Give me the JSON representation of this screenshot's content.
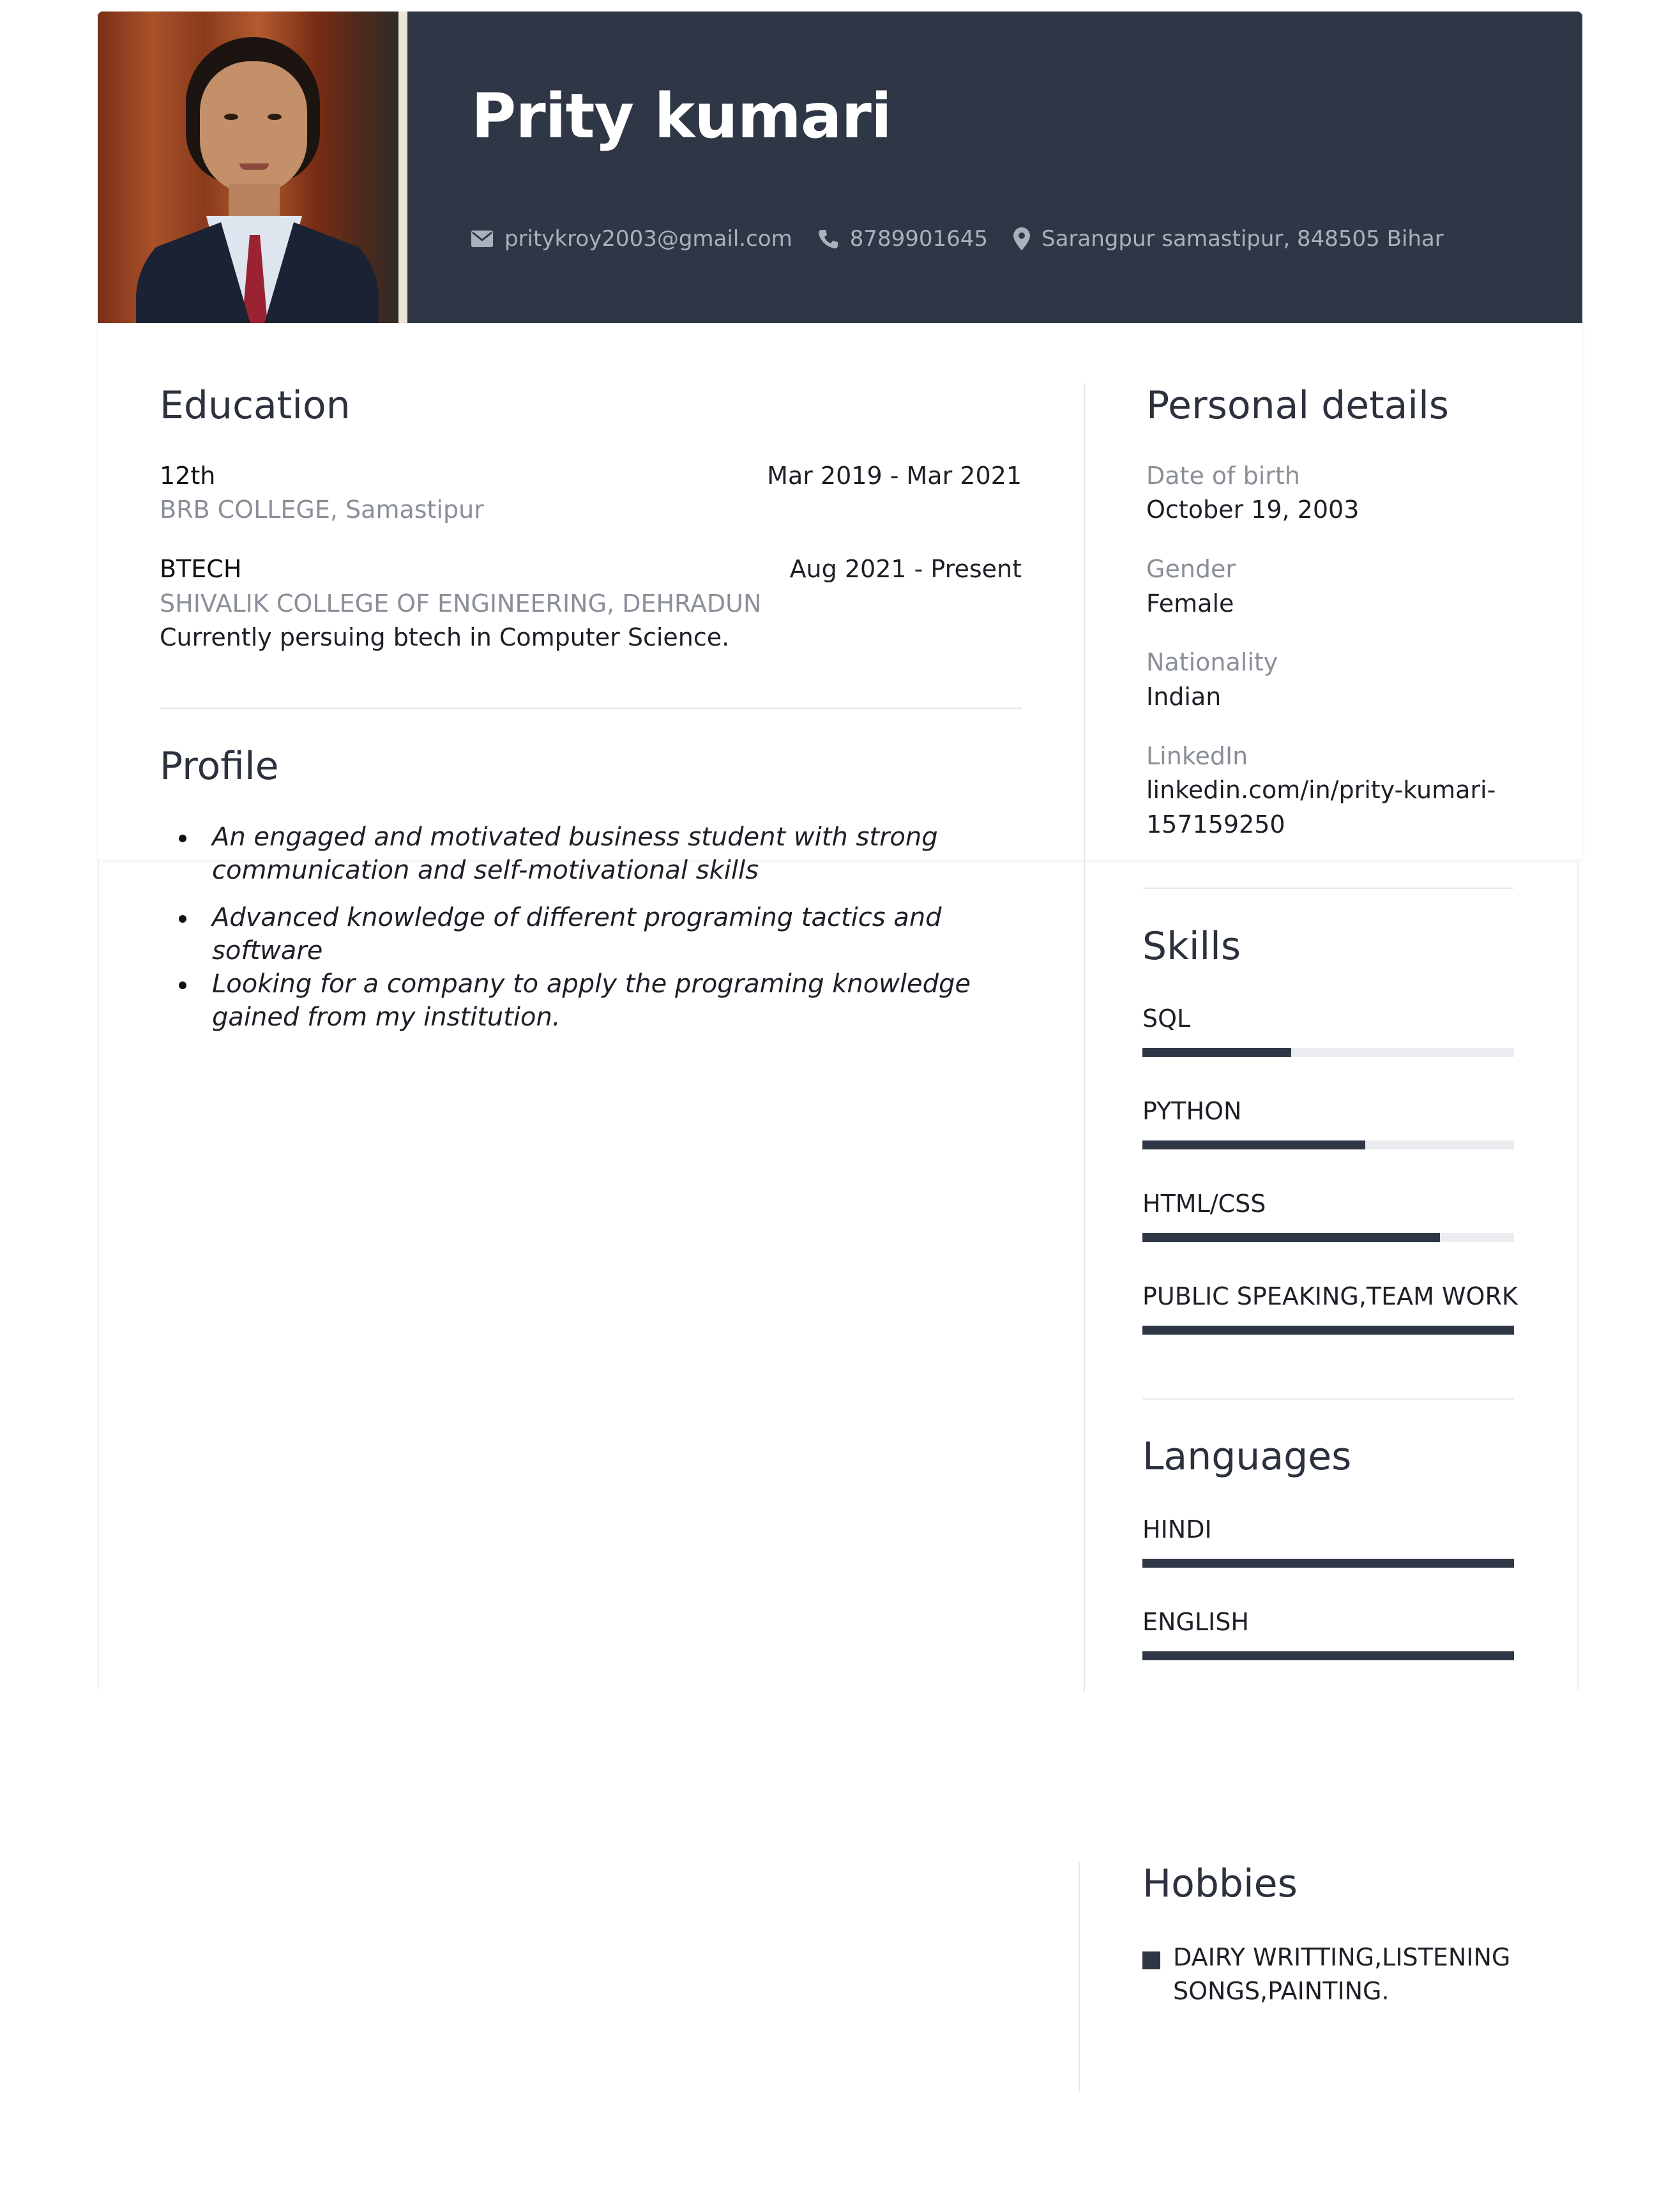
{
  "header": {
    "name": "Prity kumari",
    "email": "pritykroy2003@gmail.com",
    "phone": "8789901645",
    "address": "Sarangpur samastipur, 848505 Bihar",
    "icons": [
      "envelope-icon",
      "phone-icon",
      "location-pin-icon"
    ]
  },
  "education": {
    "title": "Education",
    "items": [
      {
        "degree": "12th",
        "dates": "Mar 2019 - Mar 2021",
        "school": "BRB COLLEGE, Samastipur",
        "note": ""
      },
      {
        "degree": "BTECH",
        "dates": "Aug 2021 - Present",
        "school": "SHIVALIK COLLEGE OF ENGINEERING, DEHRADUN",
        "note": "Currently persuing btech in Computer Science."
      }
    ]
  },
  "profile": {
    "title": "Profile",
    "items": [
      {
        "line1": "An engaged and motivated business student with strong",
        "line2": "communication and self-motivational skills"
      },
      {
        "line1": "Advanced knowledge of different programing tactics and",
        "line2": "software"
      },
      {
        "line1": "Looking for a company to apply the programing  knowledge",
        "line2": "gained from my institution."
      }
    ]
  },
  "personal": {
    "title": "Personal details",
    "fields": [
      {
        "label": "Date of birth",
        "value": "October 19, 2003"
      },
      {
        "label": "Gender",
        "value": "Female"
      },
      {
        "label": "Nationality",
        "value": "Indian"
      },
      {
        "label": "LinkedIn",
        "value_line1": "linkedin.com/in/prity-kumari-",
        "value_line2": "157159250"
      }
    ]
  },
  "skills": {
    "title": "Skills",
    "items": [
      {
        "name": "SQL",
        "level": 0.4
      },
      {
        "name": "PYTHON",
        "level": 0.6
      },
      {
        "name": "HTML/CSS",
        "level": 0.8
      },
      {
        "name": "PUBLIC SPEAKING,TEAM WORK",
        "level": 1.0
      }
    ]
  },
  "languages": {
    "title": "Languages",
    "items": [
      {
        "name": "HINDI",
        "level": 1.0
      },
      {
        "name": "ENGLISH",
        "level": 1.0
      }
    ]
  },
  "hobbies": {
    "title": "Hobbies",
    "line1": "DAIRY WRITTING,LISTENING",
    "line2": "SONGS,PAINTING."
  },
  "colors": {
    "header_bg": "#2f3646",
    "accent": "#2f3646",
    "muted_text": "#8a8f98"
  }
}
